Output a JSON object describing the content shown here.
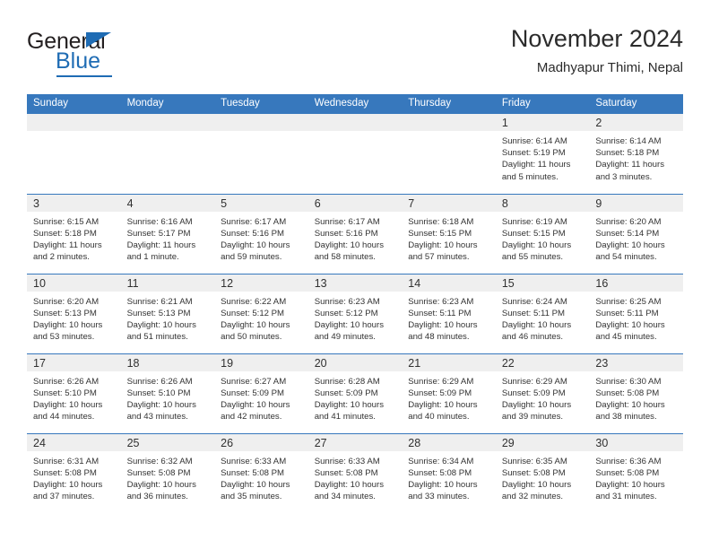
{
  "brand": {
    "name_dark": "General",
    "name_blue": "Blue",
    "accent_color": "#1f6cb4"
  },
  "header": {
    "title": "November 2024",
    "subtitle": "Madhyapur Thimi, Nepal",
    "header_bg_color": "#3778bd",
    "daynum_band_color": "#efefef"
  },
  "calendar": {
    "weekday_headers": [
      "Sunday",
      "Monday",
      "Tuesday",
      "Wednesday",
      "Thursday",
      "Friday",
      "Saturday"
    ],
    "weeks": [
      [
        {
          "day": "",
          "sunrise": "",
          "sunset": "",
          "daylight1": "",
          "daylight2": ""
        },
        {
          "day": "",
          "sunrise": "",
          "sunset": "",
          "daylight1": "",
          "daylight2": ""
        },
        {
          "day": "",
          "sunrise": "",
          "sunset": "",
          "daylight1": "",
          "daylight2": ""
        },
        {
          "day": "",
          "sunrise": "",
          "sunset": "",
          "daylight1": "",
          "daylight2": ""
        },
        {
          "day": "",
          "sunrise": "",
          "sunset": "",
          "daylight1": "",
          "daylight2": ""
        },
        {
          "day": "1",
          "sunrise": "Sunrise: 6:14 AM",
          "sunset": "Sunset: 5:19 PM",
          "daylight1": "Daylight: 11 hours",
          "daylight2": "and 5 minutes."
        },
        {
          "day": "2",
          "sunrise": "Sunrise: 6:14 AM",
          "sunset": "Sunset: 5:18 PM",
          "daylight1": "Daylight: 11 hours",
          "daylight2": "and 3 minutes."
        }
      ],
      [
        {
          "day": "3",
          "sunrise": "Sunrise: 6:15 AM",
          "sunset": "Sunset: 5:18 PM",
          "daylight1": "Daylight: 11 hours",
          "daylight2": "and 2 minutes."
        },
        {
          "day": "4",
          "sunrise": "Sunrise: 6:16 AM",
          "sunset": "Sunset: 5:17 PM",
          "daylight1": "Daylight: 11 hours",
          "daylight2": "and 1 minute."
        },
        {
          "day": "5",
          "sunrise": "Sunrise: 6:17 AM",
          "sunset": "Sunset: 5:16 PM",
          "daylight1": "Daylight: 10 hours",
          "daylight2": "and 59 minutes."
        },
        {
          "day": "6",
          "sunrise": "Sunrise: 6:17 AM",
          "sunset": "Sunset: 5:16 PM",
          "daylight1": "Daylight: 10 hours",
          "daylight2": "and 58 minutes."
        },
        {
          "day": "7",
          "sunrise": "Sunrise: 6:18 AM",
          "sunset": "Sunset: 5:15 PM",
          "daylight1": "Daylight: 10 hours",
          "daylight2": "and 57 minutes."
        },
        {
          "day": "8",
          "sunrise": "Sunrise: 6:19 AM",
          "sunset": "Sunset: 5:15 PM",
          "daylight1": "Daylight: 10 hours",
          "daylight2": "and 55 minutes."
        },
        {
          "day": "9",
          "sunrise": "Sunrise: 6:20 AM",
          "sunset": "Sunset: 5:14 PM",
          "daylight1": "Daylight: 10 hours",
          "daylight2": "and 54 minutes."
        }
      ],
      [
        {
          "day": "10",
          "sunrise": "Sunrise: 6:20 AM",
          "sunset": "Sunset: 5:13 PM",
          "daylight1": "Daylight: 10 hours",
          "daylight2": "and 53 minutes."
        },
        {
          "day": "11",
          "sunrise": "Sunrise: 6:21 AM",
          "sunset": "Sunset: 5:13 PM",
          "daylight1": "Daylight: 10 hours",
          "daylight2": "and 51 minutes."
        },
        {
          "day": "12",
          "sunrise": "Sunrise: 6:22 AM",
          "sunset": "Sunset: 5:12 PM",
          "daylight1": "Daylight: 10 hours",
          "daylight2": "and 50 minutes."
        },
        {
          "day": "13",
          "sunrise": "Sunrise: 6:23 AM",
          "sunset": "Sunset: 5:12 PM",
          "daylight1": "Daylight: 10 hours",
          "daylight2": "and 49 minutes."
        },
        {
          "day": "14",
          "sunrise": "Sunrise: 6:23 AM",
          "sunset": "Sunset: 5:11 PM",
          "daylight1": "Daylight: 10 hours",
          "daylight2": "and 48 minutes."
        },
        {
          "day": "15",
          "sunrise": "Sunrise: 6:24 AM",
          "sunset": "Sunset: 5:11 PM",
          "daylight1": "Daylight: 10 hours",
          "daylight2": "and 46 minutes."
        },
        {
          "day": "16",
          "sunrise": "Sunrise: 6:25 AM",
          "sunset": "Sunset: 5:11 PM",
          "daylight1": "Daylight: 10 hours",
          "daylight2": "and 45 minutes."
        }
      ],
      [
        {
          "day": "17",
          "sunrise": "Sunrise: 6:26 AM",
          "sunset": "Sunset: 5:10 PM",
          "daylight1": "Daylight: 10 hours",
          "daylight2": "and 44 minutes."
        },
        {
          "day": "18",
          "sunrise": "Sunrise: 6:26 AM",
          "sunset": "Sunset: 5:10 PM",
          "daylight1": "Daylight: 10 hours",
          "daylight2": "and 43 minutes."
        },
        {
          "day": "19",
          "sunrise": "Sunrise: 6:27 AM",
          "sunset": "Sunset: 5:09 PM",
          "daylight1": "Daylight: 10 hours",
          "daylight2": "and 42 minutes."
        },
        {
          "day": "20",
          "sunrise": "Sunrise: 6:28 AM",
          "sunset": "Sunset: 5:09 PM",
          "daylight1": "Daylight: 10 hours",
          "daylight2": "and 41 minutes."
        },
        {
          "day": "21",
          "sunrise": "Sunrise: 6:29 AM",
          "sunset": "Sunset: 5:09 PM",
          "daylight1": "Daylight: 10 hours",
          "daylight2": "and 40 minutes."
        },
        {
          "day": "22",
          "sunrise": "Sunrise: 6:29 AM",
          "sunset": "Sunset: 5:09 PM",
          "daylight1": "Daylight: 10 hours",
          "daylight2": "and 39 minutes."
        },
        {
          "day": "23",
          "sunrise": "Sunrise: 6:30 AM",
          "sunset": "Sunset: 5:08 PM",
          "daylight1": "Daylight: 10 hours",
          "daylight2": "and 38 minutes."
        }
      ],
      [
        {
          "day": "24",
          "sunrise": "Sunrise: 6:31 AM",
          "sunset": "Sunset: 5:08 PM",
          "daylight1": "Daylight: 10 hours",
          "daylight2": "and 37 minutes."
        },
        {
          "day": "25",
          "sunrise": "Sunrise: 6:32 AM",
          "sunset": "Sunset: 5:08 PM",
          "daylight1": "Daylight: 10 hours",
          "daylight2": "and 36 minutes."
        },
        {
          "day": "26",
          "sunrise": "Sunrise: 6:33 AM",
          "sunset": "Sunset: 5:08 PM",
          "daylight1": "Daylight: 10 hours",
          "daylight2": "and 35 minutes."
        },
        {
          "day": "27",
          "sunrise": "Sunrise: 6:33 AM",
          "sunset": "Sunset: 5:08 PM",
          "daylight1": "Daylight: 10 hours",
          "daylight2": "and 34 minutes."
        },
        {
          "day": "28",
          "sunrise": "Sunrise: 6:34 AM",
          "sunset": "Sunset: 5:08 PM",
          "daylight1": "Daylight: 10 hours",
          "daylight2": "and 33 minutes."
        },
        {
          "day": "29",
          "sunrise": "Sunrise: 6:35 AM",
          "sunset": "Sunset: 5:08 PM",
          "daylight1": "Daylight: 10 hours",
          "daylight2": "and 32 minutes."
        },
        {
          "day": "30",
          "sunrise": "Sunrise: 6:36 AM",
          "sunset": "Sunset: 5:08 PM",
          "daylight1": "Daylight: 10 hours",
          "daylight2": "and 31 minutes."
        }
      ]
    ]
  }
}
